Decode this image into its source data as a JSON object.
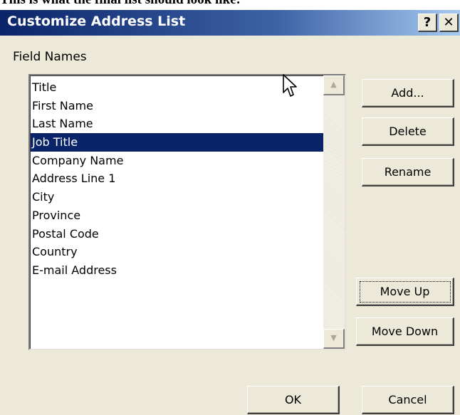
{
  "caption": "This is what the final list should look like:",
  "dialog": {
    "title": "Customize Address List",
    "help_button": "?",
    "close_button": "✕",
    "field_names_label": "Field Names",
    "fields": [
      "Title",
      "First Name",
      "Last Name",
      "Job Title",
      "Company Name",
      "Address Line 1",
      "City",
      "Province",
      "Postal Code",
      "Country",
      "E-mail Address"
    ],
    "selected_field": "Job Title",
    "buttons": {
      "add": "Add...",
      "delete": "Delete",
      "rename": "Rename",
      "move_up": "Move Up",
      "move_down": "Move Down",
      "ok": "OK",
      "cancel": "Cancel"
    }
  },
  "colors": {
    "title_bar": "#0b246a",
    "selection": "#0a246a",
    "dialog_face": "#ece9d8"
  },
  "icons": {
    "scroll_up": "scroll-up-arrow-icon",
    "scroll_down": "scroll-down-arrow-icon",
    "cursor": "mouse-pointer-icon"
  }
}
